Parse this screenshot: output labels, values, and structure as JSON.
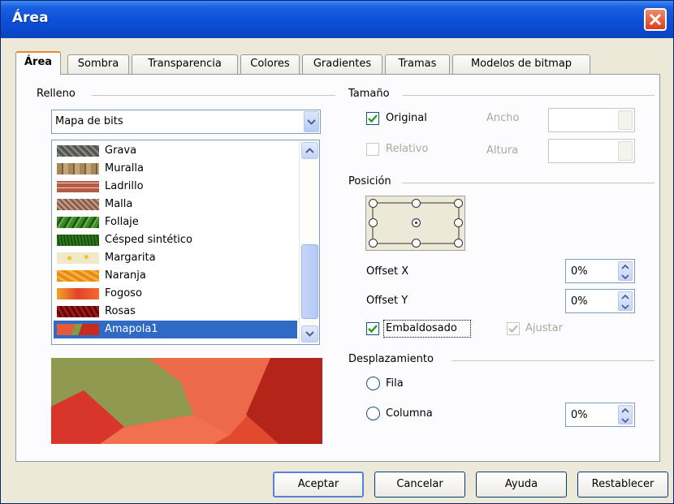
{
  "window": {
    "title": "Área"
  },
  "tabs": [
    {
      "label": "Área",
      "active": true
    },
    {
      "label": "Sombra",
      "active": false
    },
    {
      "label": "Transparencia",
      "active": false
    },
    {
      "label": "Colores",
      "active": false
    },
    {
      "label": "Gradientes",
      "active": false
    },
    {
      "label": "Tramas",
      "active": false
    },
    {
      "label": "Modelos de bitmap",
      "active": false
    }
  ],
  "relleno": {
    "label": "Relleno",
    "type_select": "Mapa de bits",
    "items": [
      {
        "label": "Grava",
        "color": "#6b6e6a"
      },
      {
        "label": "Muralla",
        "color": "#a8865a"
      },
      {
        "label": "Ladrillo",
        "color": "#b55a44"
      },
      {
        "label": "Malla",
        "color": "#8a5f4c"
      },
      {
        "label": "Follaje",
        "color": "#3e8a2a"
      },
      {
        "label": "Césped sintético",
        "color": "#2f7a1f"
      },
      {
        "label": "Margarita",
        "color": "#efe9c9"
      },
      {
        "label": "Naranja",
        "color": "#e88a1a"
      },
      {
        "label": "Fogoso",
        "color": "#e2422a"
      },
      {
        "label": "Rosas",
        "color": "#a11818"
      },
      {
        "label": "Amapola1",
        "color": "#d24330",
        "selected": true
      }
    ]
  },
  "tamano": {
    "label": "Tamaño",
    "original": {
      "label": "Original",
      "checked": true
    },
    "relativo": {
      "label": "Relativo",
      "checked": false
    },
    "ancho_label": "Ancho",
    "altura_label": "Altura"
  },
  "posicion": {
    "label": "Posición",
    "offset_x_label": "Offset X",
    "offset_x_value": "0%",
    "offset_y_label": "Offset Y",
    "offset_y_value": "0%",
    "embaldosado": {
      "label": "Embaldosado",
      "checked": true
    },
    "ajustar": {
      "label": "Ajustar",
      "checked": true
    }
  },
  "desplazamiento": {
    "label": "Desplazamiento",
    "fila_label": "Fila",
    "columna_label": "Columna",
    "value": "0%"
  },
  "buttons": {
    "aceptar": "Aceptar",
    "cancelar": "Cancelar",
    "ayuda": "Ayuda",
    "restablecer": "Restablecer"
  },
  "colors": {
    "titlebar": "#0b4fd8",
    "selection": "#316ac5",
    "close": "#d6411c",
    "active_tab_accent": "#e68b2c"
  }
}
